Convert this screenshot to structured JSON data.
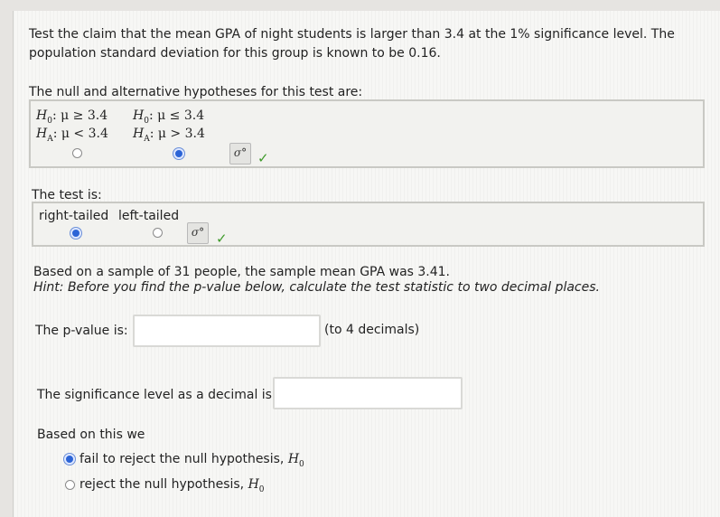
{
  "question": {
    "line1": "Test the claim that the mean GPA of night students is larger than 3.4 at the 1% significance level. The",
    "line2": "population standard deviation for this group is known to be 0.16."
  },
  "hypotheses": {
    "prompt": "The null and alternative hypotheses for this test are:",
    "options": [
      {
        "h0_lhs": "H",
        "h0_sub": "0",
        "h0_rel": ": μ ≥ 3.4",
        "ha_lhs": "H",
        "ha_sub": "A",
        "ha_rel": ": μ < 3.4",
        "selected": false
      },
      {
        "h0_lhs": "H",
        "h0_sub": "0",
        "h0_rel": ": μ ≤ 3.4",
        "ha_lhs": "H",
        "ha_sub": "A",
        "ha_rel": ": μ > 3.4",
        "selected": true
      }
    ],
    "sigma_button": "σ°",
    "check": "✓"
  },
  "test_type": {
    "prompt": "The test is:",
    "options": [
      {
        "label": "right-tailed",
        "selected": true
      },
      {
        "label": "left-tailed",
        "selected": false
      }
    ],
    "sigma_button": "σ°",
    "check": "✓"
  },
  "sample": {
    "text": "Based on a sample of 31 people, the sample mean GPA was 3.41.",
    "hint": "Hint: Before you find the p-value below, calculate the test statistic to two decimal places."
  },
  "pvalue": {
    "label": "The p-value is:",
    "value": "",
    "suffix": "(to 4 decimals)"
  },
  "significance": {
    "label": "The significance level as a decimal is:",
    "value": ""
  },
  "conclusion": {
    "prompt": "Based on this we",
    "options": [
      {
        "text": "fail to reject the null hypothesis, ",
        "math": "H",
        "sub": "0",
        "selected": true
      },
      {
        "text": "reject the null hypothesis, ",
        "math": "H",
        "sub": "0",
        "selected": false
      }
    ]
  },
  "colors": {
    "selected_radio": "#2c64d6",
    "check": "#3e9a2a"
  }
}
